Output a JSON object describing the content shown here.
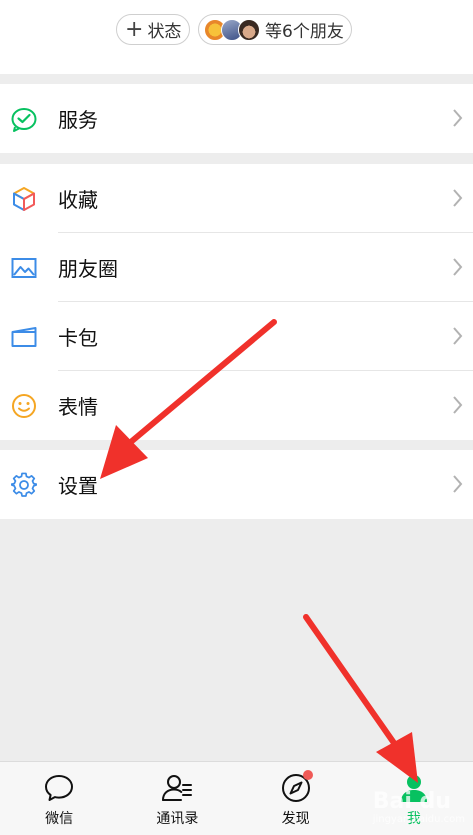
{
  "status_bar": {
    "add_status_plus": "+",
    "add_status_label": "状态",
    "friends_label": "等6个朋友"
  },
  "menu": {
    "service": {
      "label": "服务",
      "icon": "wechat-pay-icon"
    },
    "items": [
      {
        "label": "收藏",
        "icon": "cube-icon"
      },
      {
        "label": "朋友圈",
        "icon": "photo-icon"
      },
      {
        "label": "卡包",
        "icon": "card-wallet-icon"
      },
      {
        "label": "表情",
        "icon": "smiley-icon"
      }
    ],
    "settings": {
      "label": "设置",
      "icon": "gear-icon"
    }
  },
  "tabbar": {
    "tabs": [
      {
        "label": "微信",
        "icon": "chat-bubble-icon"
      },
      {
        "label": "通讯录",
        "icon": "contacts-icon"
      },
      {
        "label": "发现",
        "icon": "compass-icon"
      },
      {
        "label": "我",
        "icon": "person-icon",
        "active": true
      }
    ]
  },
  "watermark": {
    "text": "Bai du",
    "sub": "jingyan.baidu.com"
  },
  "colors": {
    "accent": "#07c160",
    "badge": "#f05a57",
    "annotation_arrow": "#f0312b"
  }
}
